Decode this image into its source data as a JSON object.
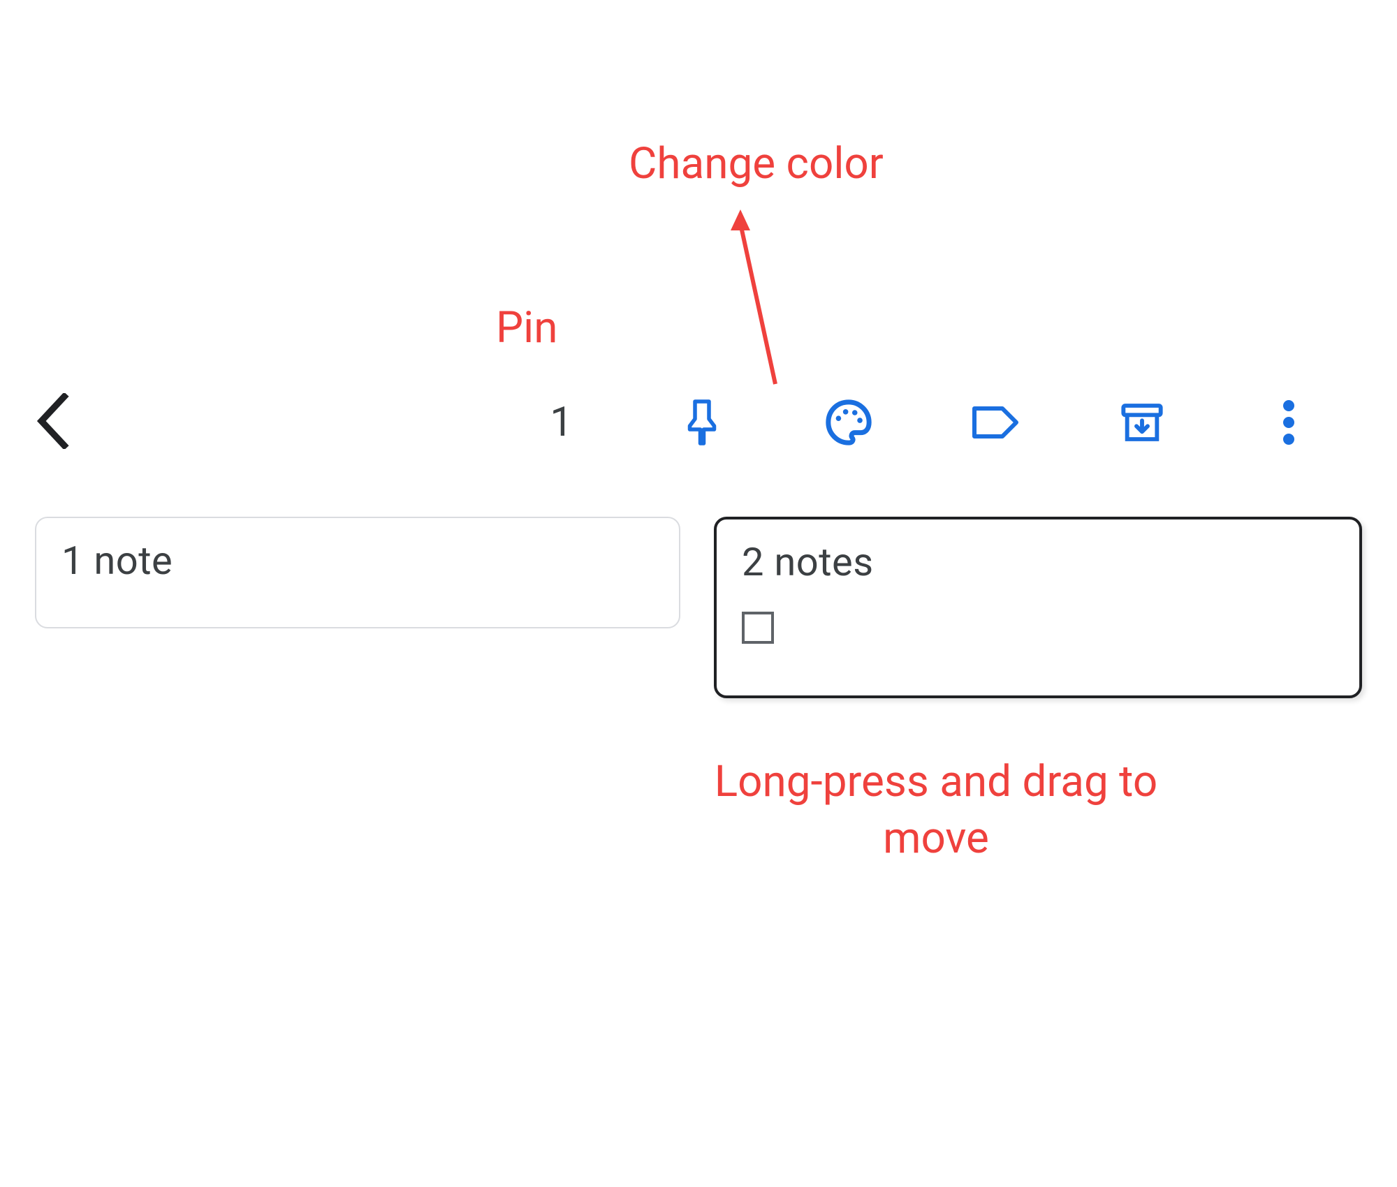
{
  "toolbar": {
    "selected_count": "1"
  },
  "notes": [
    {
      "title": "1 note"
    },
    {
      "title": "2 notes"
    }
  ],
  "annotations": {
    "pin": "Pin",
    "change_color": "Change color",
    "drag": "Long-press and drag to move"
  },
  "colors": {
    "accent_blue": "#1a73e8",
    "annotation_red": "#ef413d",
    "text_dark": "#3c4043"
  }
}
